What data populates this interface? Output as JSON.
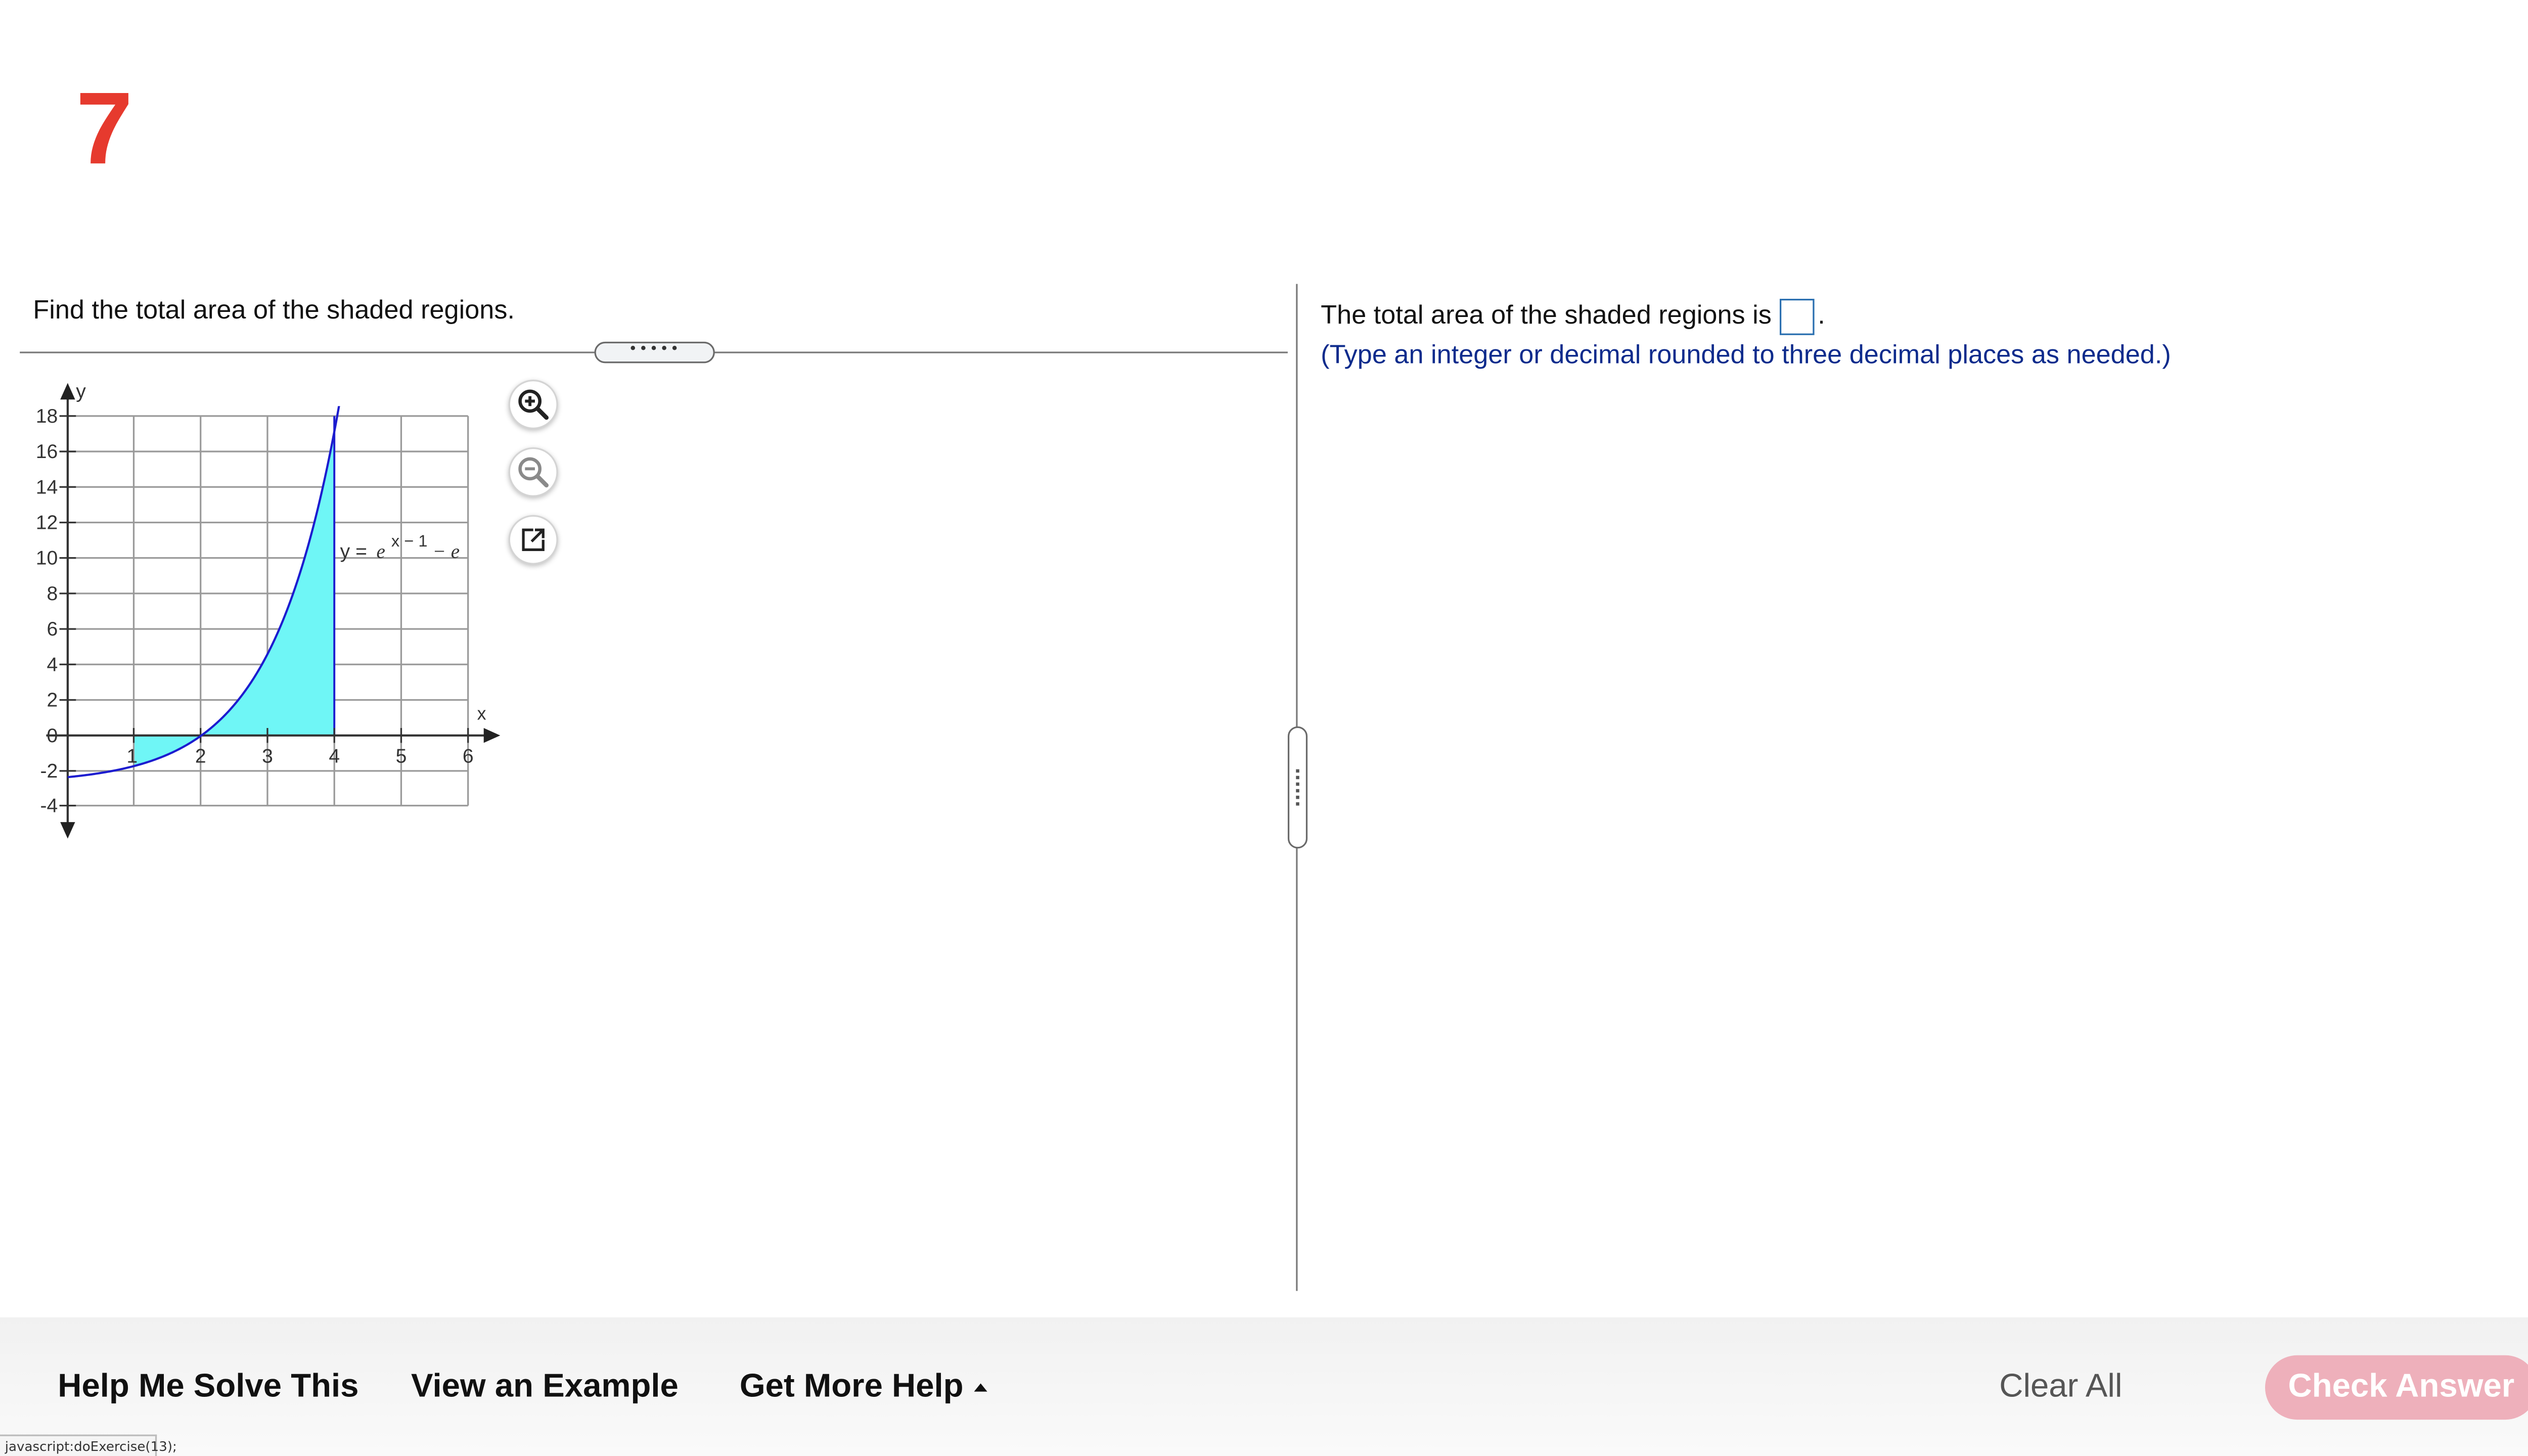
{
  "question": {
    "number": "7",
    "prompt": "Find the total area of the shaded regions."
  },
  "graph": {
    "y_axis_label": "y",
    "x_axis_label": "x",
    "y_tick_labels": [
      "18",
      "16",
      "14",
      "12",
      "10",
      "8",
      "6",
      "4",
      "2",
      "0",
      "-2",
      "-4"
    ],
    "x_tick_labels": [
      "1",
      "2",
      "3",
      "4",
      "5",
      "6"
    ],
    "curve_label_prefix": "y = ",
    "curve_label_base": "e",
    "curve_label_exponent": "x − 1",
    "curve_label_suffix": " − e",
    "curve_color": "#1c1ccf",
    "shade_color": "#6ff6f6",
    "x_range": [
      0,
      6
    ],
    "y_range": [
      -4,
      18
    ],
    "shaded_interval": [
      1,
      4
    ]
  },
  "tools": {
    "zoom_in_icon": "zoom-in-icon",
    "zoom_out_icon": "zoom-out-icon",
    "popout_icon": "external-link-icon"
  },
  "splitter": {
    "horizontal_grip": "•••••"
  },
  "answer": {
    "text": "The total area of the shaded regions is",
    "period": ".",
    "hint": "(Type an integer or decimal rounded to three decimal places as needed.)",
    "value": ""
  },
  "footer": {
    "help_me_solve": "Help Me Solve This",
    "view_example": "View an Example",
    "get_more_help": "Get More Help",
    "clear_all": "Clear All",
    "check_answer": "Check Answer",
    "accent_color": "#e63a2e",
    "check_color": "#eeb0bb"
  },
  "status_bar": {
    "text": "javascript:doExercise(13);"
  }
}
